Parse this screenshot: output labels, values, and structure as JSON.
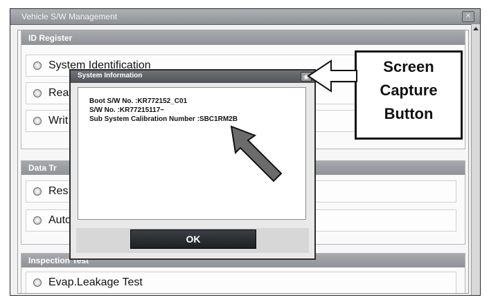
{
  "window": {
    "title": "Vehicle S/W Management",
    "close_icon": "close-icon"
  },
  "sections": {
    "id_register": {
      "title": "ID Register",
      "items": [
        "System Identification",
        "Rea",
        "Writ"
      ]
    },
    "data_transfer": {
      "title": "Data Tr",
      "items": [
        "Res",
        "Auto"
      ]
    },
    "inspection": {
      "title": "Inspection Test",
      "items": [
        "Evap.Leakage Test"
      ]
    }
  },
  "dialog": {
    "title": "System Information",
    "lines": [
      "Boot S/W No. :KR772152_C01",
      "S/W No. :KR77215117~",
      "Sub System Calibration Number :SBC1RM2B"
    ],
    "ok_label": "OK"
  },
  "callout": {
    "lines": [
      "Screen",
      "Capture",
      "Button"
    ]
  },
  "colors": {
    "title_bar": "#8e9196",
    "dialog_button": "#1e2023",
    "callout_border": "#111111"
  }
}
